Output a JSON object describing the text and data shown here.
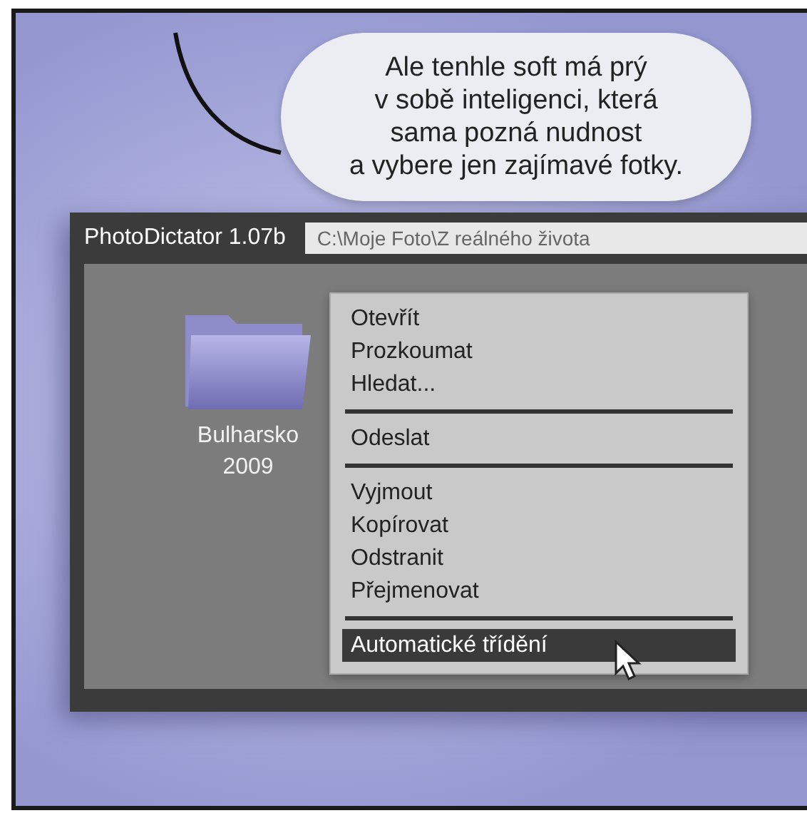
{
  "speech_bubble": {
    "text": "Ale tenhle soft má prý\nv sobě inteligenci, která\nsama pozná nudnost\na vybere jen zajímavé fotky."
  },
  "window": {
    "title": "PhotoDictator 1.07b",
    "path": "C:\\Moje Foto\\Z reálného života"
  },
  "folders": [
    {
      "label": "Bulharsko\n2009"
    }
  ],
  "context_menu": {
    "items": [
      {
        "kind": "item",
        "label": "Otevřít",
        "selected": false
      },
      {
        "kind": "item",
        "label": "Prozkoumat",
        "selected": false
      },
      {
        "kind": "item",
        "label": "Hledat...",
        "selected": false
      },
      {
        "kind": "separator"
      },
      {
        "kind": "item",
        "label": "Odeslat",
        "selected": false
      },
      {
        "kind": "separator"
      },
      {
        "kind": "item",
        "label": "Vyjmout",
        "selected": false
      },
      {
        "kind": "item",
        "label": "Kopírovat",
        "selected": false
      },
      {
        "kind": "item",
        "label": "Odstranit",
        "selected": false
      },
      {
        "kind": "item",
        "label": "Přejmenovat",
        "selected": false
      },
      {
        "kind": "separator"
      },
      {
        "kind": "item",
        "label": "Automatické třídění",
        "selected": true
      }
    ]
  }
}
